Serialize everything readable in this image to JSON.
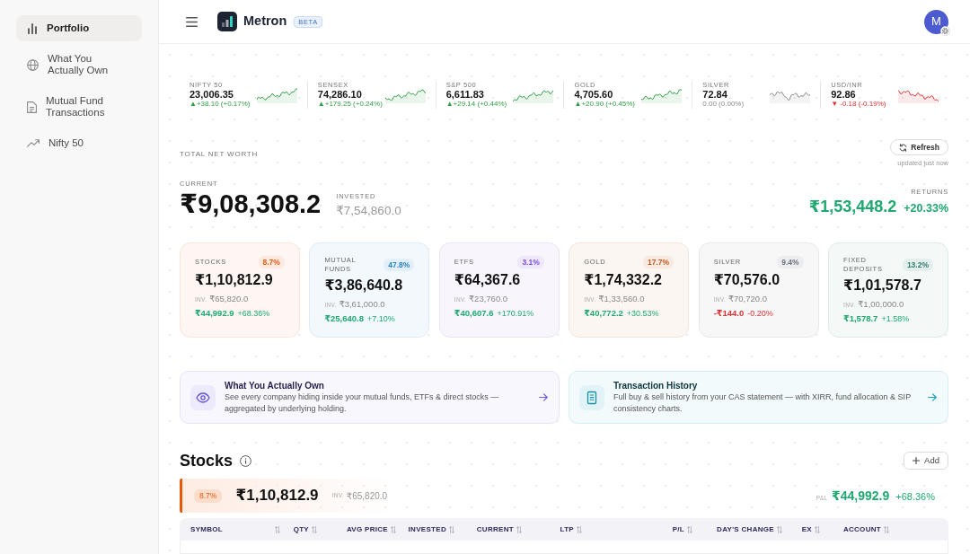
{
  "sidebar": {
    "items": [
      {
        "label": "Portfolio",
        "kind": "chart",
        "selected": true
      },
      {
        "label": "What You Actually Own",
        "kind": "globe",
        "selected": false
      },
      {
        "label": "Mutual Fund Transactions",
        "kind": "document",
        "selected": false
      },
      {
        "label": "Nifty 50",
        "kind": "trend",
        "selected": false
      }
    ]
  },
  "header": {
    "app_name": "Metron",
    "badge": "BETA",
    "avatar_initial": "M"
  },
  "tickers": [
    {
      "label": "NIFTY 50",
      "value": "23,006.35",
      "change": "▲+38.10 (+0.17%)",
      "rising": true,
      "falling": false
    },
    {
      "label": "SENSEX",
      "value": "74,286.10",
      "change": "▲+179.25 (+0.24%)",
      "rising": true,
      "falling": false
    },
    {
      "label": "S&P 500",
      "value": "6,611.83",
      "change": "▲+29.14 (+0.44%)",
      "rising": true,
      "falling": false
    },
    {
      "label": "GOLD",
      "value": "4,705.60",
      "change": "▲+20.90 (+0.45%)",
      "rising": true,
      "falling": false
    },
    {
      "label": "SILVER",
      "value": "72.84",
      "change": "0.00 (0.00%)",
      "rising": false,
      "falling": false
    },
    {
      "label": "USD/INR",
      "value": "92.86",
      "change": "▼ -0.18 (-0.19%)",
      "rising": false,
      "falling": true
    }
  ],
  "net_worth": {
    "title": "TOTAL NET WORTH",
    "refresh_label": "Refresh",
    "updated": "updated just now",
    "current_label": "CURRENT",
    "current": "₹9,08,308.2",
    "invested_label": "INVESTED",
    "invested": "₹7,54,860.0",
    "returns_label": "RETURNS",
    "returns": "₹1,53,448.2",
    "returns_pct": "+20.33%",
    "falling": false
  },
  "cards": [
    {
      "label": "STOCKS",
      "share": "8.7%",
      "value": "₹1,10,812.9",
      "inv_label": "INV.",
      "invested": "₹65,820.0",
      "returns": "₹44,992.9",
      "returns_pct": "+68.36%",
      "falling": false,
      "color": "#e8590c"
    },
    {
      "label": "MUTUAL FUNDS",
      "share": "47.8%",
      "value": "₹3,86,640.8",
      "inv_label": "INV.",
      "invested": "₹3,61,000.0",
      "returns": "₹25,640.8",
      "returns_pct": "+7.10%",
      "falling": false,
      "color": "#2b83c6"
    },
    {
      "label": "ETFS",
      "share": "3.1%",
      "value": "₹64,367.6",
      "inv_label": "INV.",
      "invested": "₹23,760.0",
      "returns": "₹40,607.6",
      "returns_pct": "+170.91%",
      "falling": false,
      "color": "#7c4ddb"
    },
    {
      "label": "GOLD",
      "share": "17.7%",
      "value": "₹1,74,332.2",
      "inv_label": "INV.",
      "invested": "₹1,33,560.0",
      "returns": "₹40,772.2",
      "returns_pct": "+30.53%",
      "falling": false,
      "color": "#c8561b"
    },
    {
      "label": "SILVER",
      "share": "9.4%",
      "value": "₹70,576.0",
      "inv_label": "INV.",
      "invested": "₹70,720.0",
      "returns": "-₹144.0",
      "returns_pct": "-0.20%",
      "falling": true,
      "color": "#6b7280"
    },
    {
      "label": "FIXED DEPOSITS",
      "share": "13.2%",
      "value": "₹1,01,578.7",
      "inv_label": "INV.",
      "invested": "₹1,00,000.0",
      "returns": "₹1,578.7",
      "returns_pct": "+1.58%",
      "falling": false,
      "color": "#2f7d6d"
    }
  ],
  "banners": [
    {
      "title": "What You Actually Own",
      "description": "See every company hiding inside your mutual funds, ETFs & direct stocks — aggregated by underlying holding.",
      "kind": "eye",
      "color": "#6c5ce7"
    },
    {
      "title": "Transaction History",
      "description": "Full buy & sell history from your CAS statement — with XIRR, fund allocation & SIP consistency charts.",
      "kind": "document",
      "color": "#17a2b8"
    }
  ],
  "stocks": {
    "title": "Stocks",
    "add_label": "Add",
    "summary": {
      "share": "8.7%",
      "value": "₹1,10,812.9",
      "inv_label": "INV.",
      "invested": "₹65,820.0",
      "pnl_label": "P&L",
      "pnl": "₹44,992.9",
      "pnl_pct": "+68.36%",
      "falling": false
    },
    "table": {
      "columns": [
        {
          "label": "SYMBOL"
        },
        {
          "label": "QTY"
        },
        {
          "label": "AVG PRICE"
        },
        {
          "label": "INVESTED"
        },
        {
          "label": "CURRENT"
        },
        {
          "label": "LTP"
        },
        {
          "label": "P/L"
        },
        {
          "label": "DAY'S CHANGE"
        },
        {
          "label": "EX"
        },
        {
          "label": "ACCOUNT"
        }
      ]
    }
  }
}
